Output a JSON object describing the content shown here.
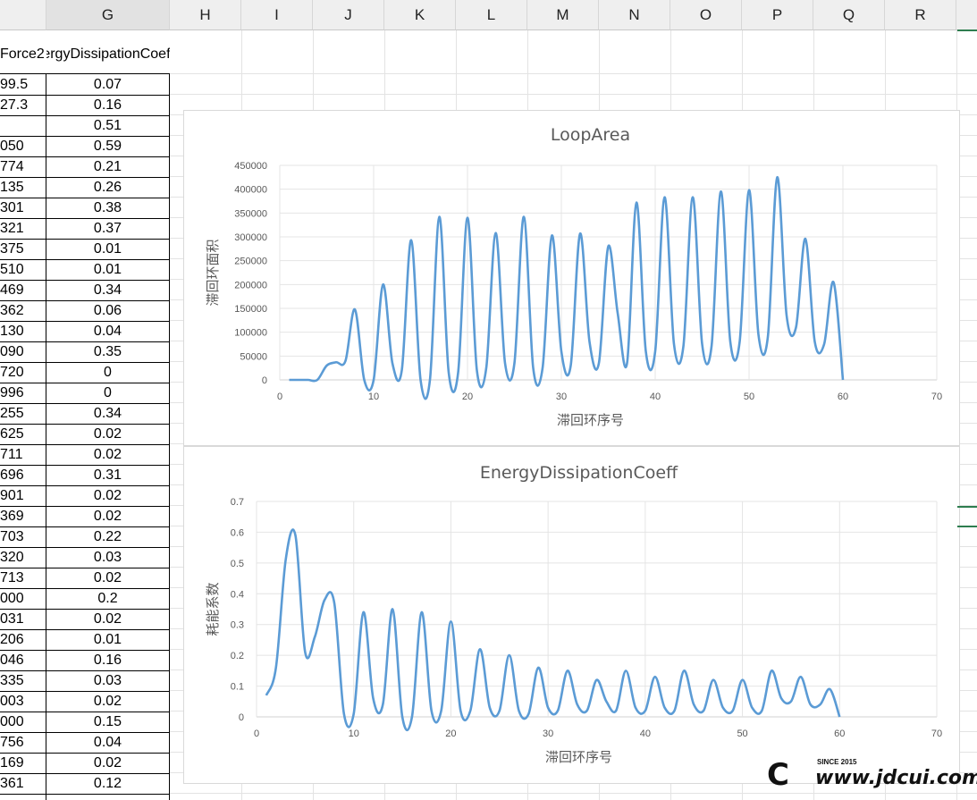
{
  "columns": [
    "G",
    "H",
    "I",
    "J",
    "K",
    "L",
    "M",
    "N",
    "O",
    "P",
    "Q",
    "R"
  ],
  "header_row": {
    "f": "Force2",
    "g": "ergyDissipationCoeff"
  },
  "rows": [
    {
      "f": "99.5",
      "g": "0.07"
    },
    {
      "f": "27.3",
      "g": "0.16"
    },
    {
      "f": "",
      "g": "0.51"
    },
    {
      "f": "050",
      "g": "0.59"
    },
    {
      "f": "774",
      "g": "0.21"
    },
    {
      "f": "135",
      "g": "0.26"
    },
    {
      "f": "301",
      "g": "0.38"
    },
    {
      "f": "321",
      "g": "0.37"
    },
    {
      "f": "375",
      "g": "0.01"
    },
    {
      "f": "510",
      "g": "0.01"
    },
    {
      "f": "469",
      "g": "0.34"
    },
    {
      "f": "362",
      "g": "0.06"
    },
    {
      "f": "130",
      "g": "0.04"
    },
    {
      "f": "090",
      "g": "0.35"
    },
    {
      "f": "720",
      "g": "0"
    },
    {
      "f": "996",
      "g": "0"
    },
    {
      "f": "255",
      "g": "0.34"
    },
    {
      "f": "625",
      "g": "0.02"
    },
    {
      "f": "711",
      "g": "0.02"
    },
    {
      "f": "696",
      "g": "0.31"
    },
    {
      "f": "901",
      "g": "0.02"
    },
    {
      "f": "369",
      "g": "0.02"
    },
    {
      "f": "703",
      "g": "0.22"
    },
    {
      "f": "320",
      "g": "0.03"
    },
    {
      "f": "713",
      "g": "0.02"
    },
    {
      "f": "000",
      "g": "0.2"
    },
    {
      "f": "031",
      "g": "0.02"
    },
    {
      "f": "206",
      "g": "0.01"
    },
    {
      "f": "046",
      "g": "0.16"
    },
    {
      "f": "335",
      "g": "0.03"
    },
    {
      "f": "003",
      "g": "0.02"
    },
    {
      "f": "000",
      "g": "0.15"
    },
    {
      "f": "756",
      "g": "0.04"
    },
    {
      "f": "169",
      "g": "0.02"
    },
    {
      "f": "361",
      "g": "0.12"
    }
  ],
  "chart_data": [
    {
      "type": "line",
      "title": "LoopArea",
      "xlabel": "滞回环序号",
      "ylabel": "滞回环面积",
      "xlim": [
        0,
        70
      ],
      "ylim": [
        0,
        450000
      ],
      "xticks": [
        "0",
        "10",
        "20",
        "30",
        "40",
        "50",
        "60",
        "70"
      ],
      "yticks": [
        "0",
        "50000",
        "100000",
        "150000",
        "200000",
        "250000",
        "300000",
        "350000",
        "400000",
        "450000"
      ],
      "grid": true,
      "color": "#5b9bd5",
      "x": [
        1,
        2,
        3,
        4,
        5,
        6,
        7,
        8,
        9,
        10,
        11,
        12,
        13,
        14,
        15,
        16,
        17,
        18,
        19,
        20,
        21,
        22,
        23,
        24,
        25,
        26,
        27,
        28,
        29,
        30,
        31,
        32,
        33,
        34,
        35,
        36,
        37,
        38,
        39,
        40,
        41,
        42,
        43,
        44,
        45,
        46,
        47,
        48,
        49,
        50,
        51,
        52,
        53,
        54,
        55,
        56,
        57,
        58,
        59,
        60
      ],
      "y": [
        0,
        0,
        0,
        0,
        30000,
        37000,
        40000,
        148000,
        0,
        0,
        200000,
        35000,
        20000,
        293000,
        0,
        0,
        342000,
        15000,
        15000,
        340000,
        20000,
        25000,
        308000,
        35000,
        35000,
        342000,
        25000,
        25000,
        303000,
        60000,
        30000,
        307000,
        80000,
        35000,
        280000,
        140000,
        35000,
        372000,
        60000,
        60000,
        383000,
        75000,
        70000,
        383000,
        75000,
        70000,
        395000,
        80000,
        80000,
        398000,
        95000,
        90000,
        425000,
        135000,
        110000,
        296000,
        80000,
        75000,
        205000,
        0
      ]
    },
    {
      "type": "line",
      "title": "EnergyDissipationCoeff",
      "xlabel": "滞回环序号",
      "ylabel": "耗能系数",
      "xlim": [
        0,
        70
      ],
      "ylim": [
        0,
        0.7
      ],
      "xticks": [
        "0",
        "10",
        "20",
        "30",
        "40",
        "50",
        "60",
        "70"
      ],
      "yticks": [
        "0",
        "0.1",
        "0.2",
        "0.3",
        "0.4",
        "0.5",
        "0.6",
        "0.7"
      ],
      "grid": true,
      "color": "#5b9bd5",
      "x": [
        1,
        2,
        3,
        4,
        5,
        6,
        7,
        8,
        9,
        10,
        11,
        12,
        13,
        14,
        15,
        16,
        17,
        18,
        19,
        20,
        21,
        22,
        23,
        24,
        25,
        26,
        27,
        28,
        29,
        30,
        31,
        32,
        33,
        34,
        35,
        36,
        37,
        38,
        39,
        40,
        41,
        42,
        43,
        44,
        45,
        46,
        47,
        48,
        49,
        50,
        51,
        52,
        53,
        54,
        55,
        56,
        57,
        58,
        59,
        60
      ],
      "y": [
        0.07,
        0.16,
        0.51,
        0.59,
        0.21,
        0.26,
        0.38,
        0.37,
        0.01,
        0.01,
        0.34,
        0.06,
        0.04,
        0.35,
        0,
        0,
        0.34,
        0.02,
        0.02,
        0.31,
        0.02,
        0.02,
        0.22,
        0.03,
        0.02,
        0.2,
        0.02,
        0.01,
        0.16,
        0.03,
        0.02,
        0.15,
        0.04,
        0.02,
        0.12,
        0.05,
        0.02,
        0.15,
        0.03,
        0.02,
        0.13,
        0.03,
        0.02,
        0.15,
        0.04,
        0.02,
        0.12,
        0.03,
        0.02,
        0.12,
        0.03,
        0.02,
        0.15,
        0.06,
        0.05,
        0.13,
        0.04,
        0.04,
        0.09,
        0
      ]
    }
  ],
  "watermark": {
    "logo": "C",
    "since": "SINCE 2015",
    "url": "www.jdcui.com"
  }
}
